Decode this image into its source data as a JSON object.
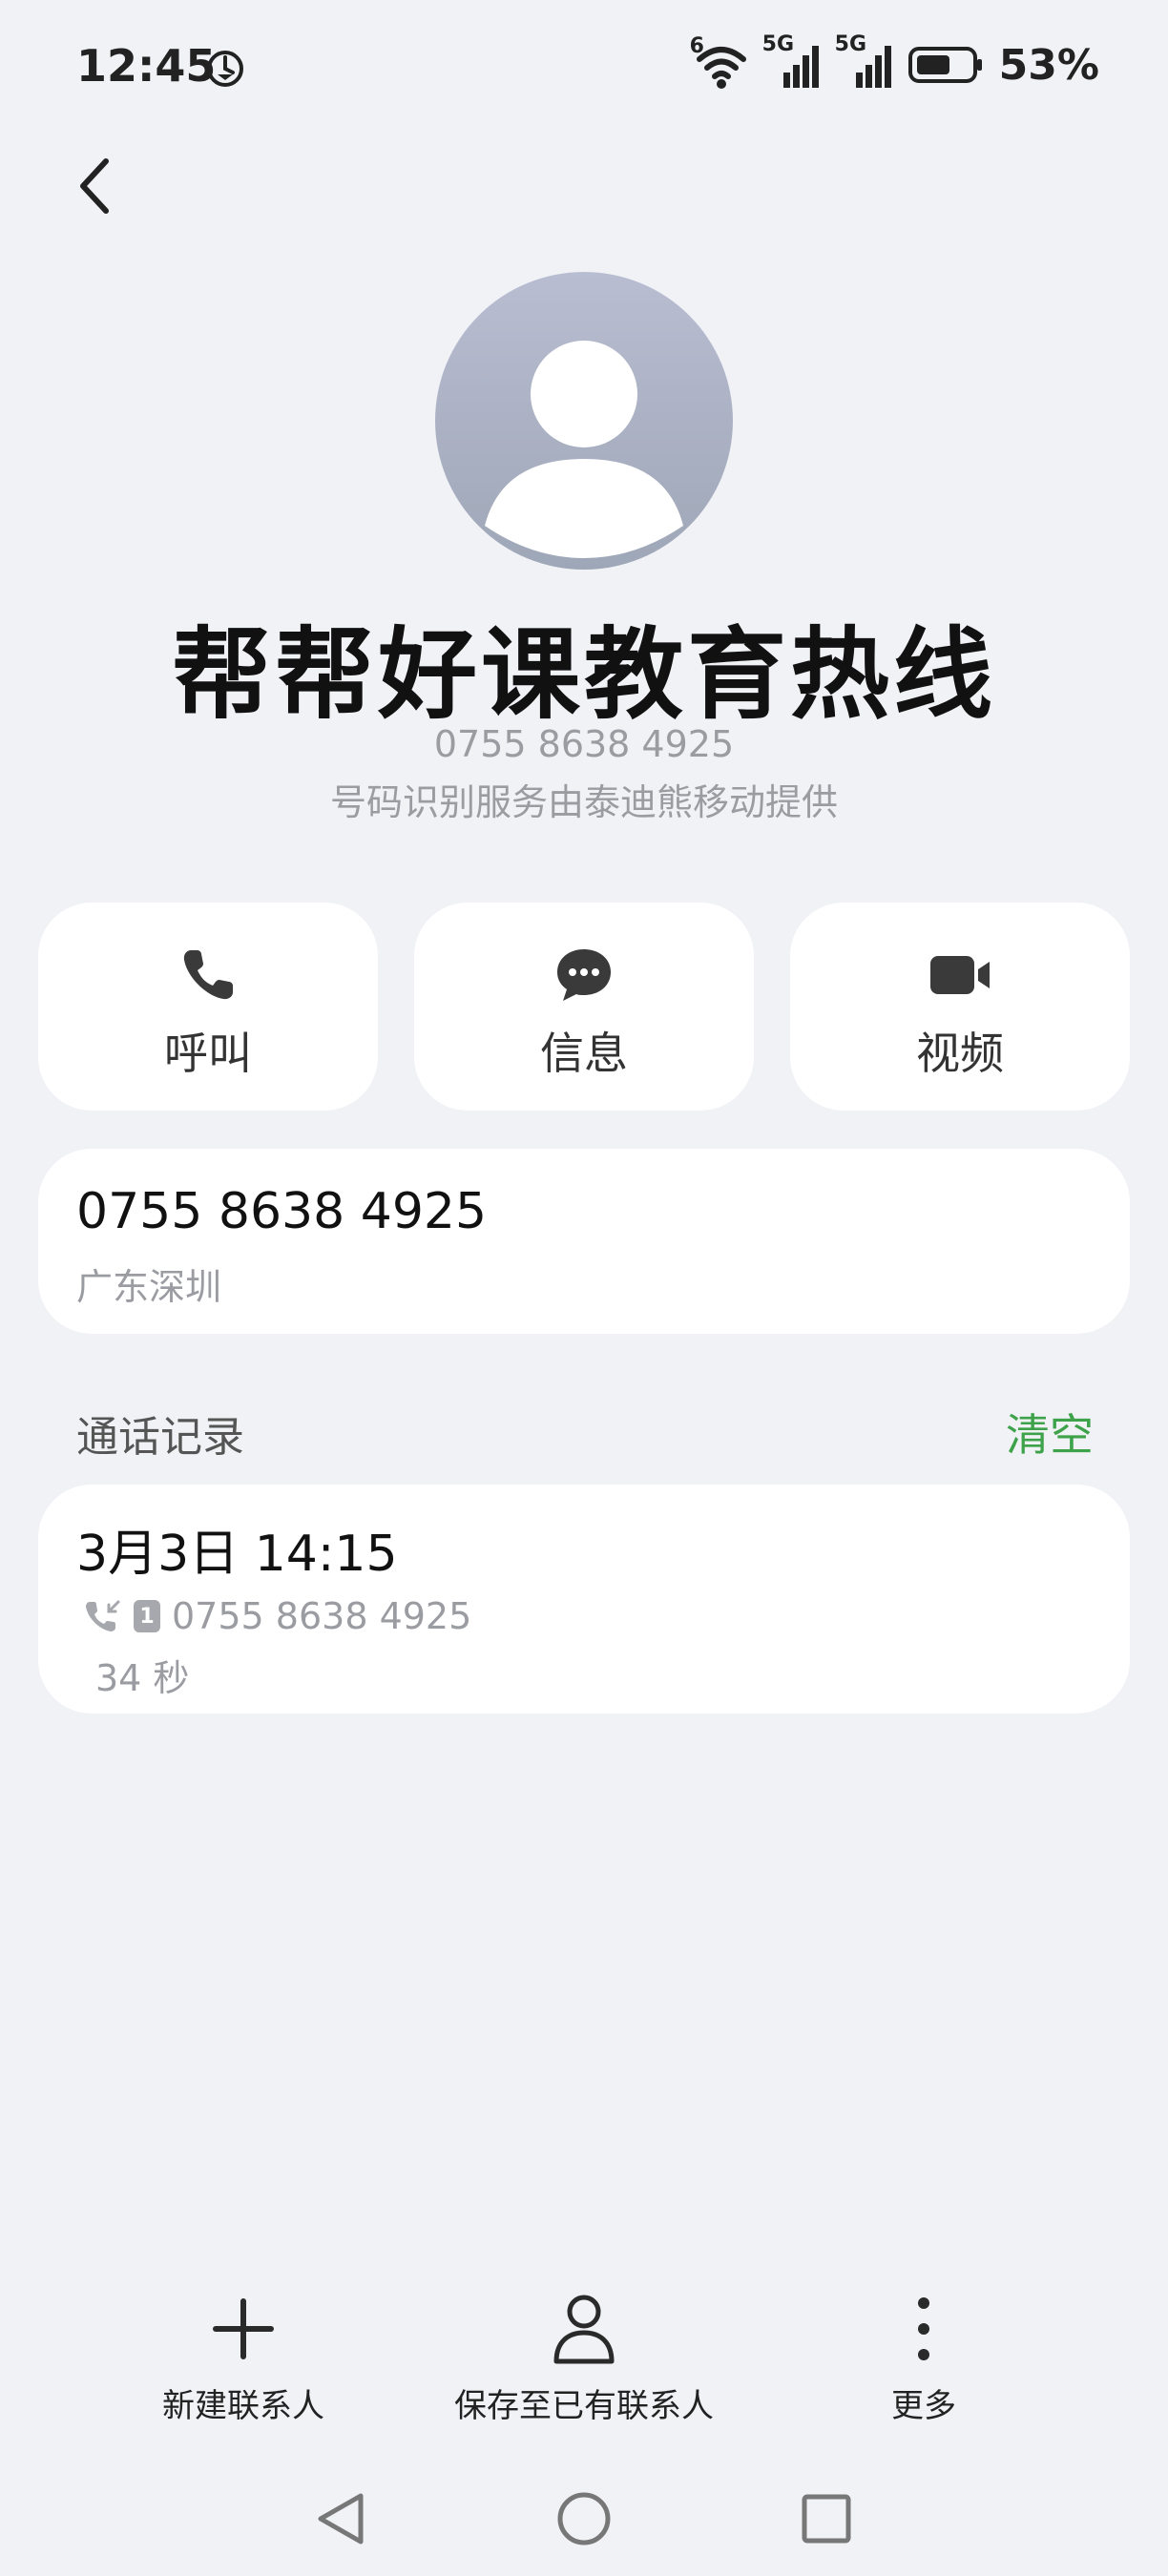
{
  "status_bar": {
    "time": "12:45",
    "network": [
      "6",
      "5G",
      "5G"
    ],
    "battery_percent": "53%"
  },
  "contact": {
    "name": "帮帮好课教育热线",
    "number": "0755 8638 4925",
    "provider_note": "号码识别服务由泰迪熊移动提供"
  },
  "actions": [
    {
      "label": "呼叫",
      "icon": "phone-icon"
    },
    {
      "label": "信息",
      "icon": "message-icon"
    },
    {
      "label": "视频",
      "icon": "video-icon"
    }
  ],
  "number_card": {
    "number": "0755 8638 4925",
    "region": "广东深圳"
  },
  "call_log": {
    "title": "通话记录",
    "clear_label": "清空",
    "entries": [
      {
        "date": "3月3日 14:15",
        "sim": "1",
        "number": "0755 8638 4925",
        "duration": "34 秒"
      }
    ]
  },
  "toolbar": [
    {
      "label": "新建联系人",
      "icon": "plus-icon"
    },
    {
      "label": "保存至已有联系人",
      "icon": "person-icon"
    },
    {
      "label": "更多",
      "icon": "more-icon"
    }
  ],
  "colors": {
    "background": "#f1f2f6",
    "card": "#ffffff",
    "accent_green": "#3ea24a",
    "secondary_text": "#9a9ca2"
  }
}
